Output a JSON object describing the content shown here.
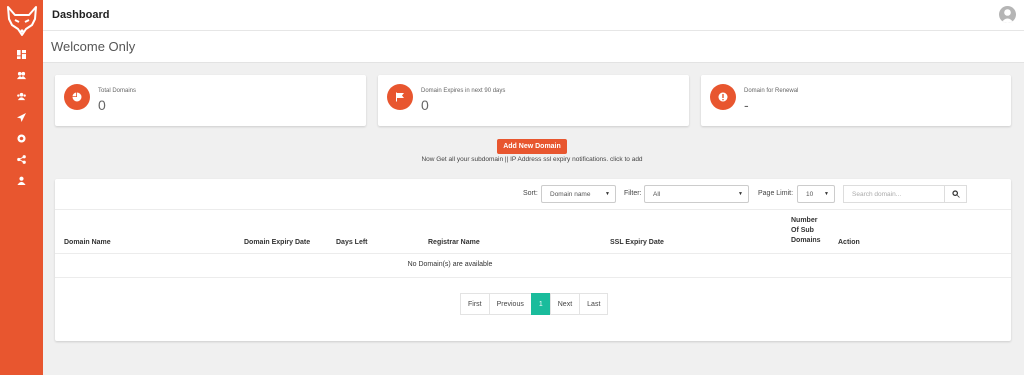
{
  "topbar": {
    "title": "Dashboard"
  },
  "subheader": {
    "welcome": "Welcome Only"
  },
  "sidebar": {
    "items": [
      {
        "icon": "dashboard-icon"
      },
      {
        "icon": "users-icon"
      },
      {
        "icon": "group-icon"
      },
      {
        "icon": "send-icon"
      },
      {
        "icon": "settings-icon"
      },
      {
        "icon": "share-icon"
      },
      {
        "icon": "user-icon"
      }
    ]
  },
  "cards": [
    {
      "label": "Total Domains",
      "value": "0",
      "icon": "pie-chart-icon"
    },
    {
      "label": "Domain Expires in next 90 days",
      "value": "0",
      "icon": "flag-icon"
    },
    {
      "label": "Domain for Renewal",
      "value": "-",
      "icon": "info-icon"
    }
  ],
  "add_domain": {
    "button_label": "Add New Domain",
    "note": "Now Get all your subdomain || IP Address ssl expiry notifications. click to add"
  },
  "filters": {
    "sort_label": "Sort:",
    "sort_value": "Domain name",
    "filter_label": "Filter:",
    "filter_value": "All",
    "page_limit_label": "Page Limit:",
    "page_limit_value": "10",
    "search_placeholder": "Search domain..."
  },
  "table": {
    "headers": {
      "domain_name": "Domain Name",
      "expiry_date": "Domain Expiry Date",
      "days_left": "Days Left",
      "registrar": "Registrar Name",
      "ssl_expiry": "SSL Expiry Date",
      "sub_domains_1": "Number",
      "sub_domains_2": "Of Sub",
      "sub_domains_3": "Domains",
      "action": "Action"
    },
    "empty_message": "No Domain(s) are available"
  },
  "pagination": {
    "first": "First",
    "previous": "Previous",
    "current": "1",
    "next": "Next",
    "last": "Last"
  },
  "colors": {
    "accent": "#e8562f",
    "active_page": "#1abc9c"
  }
}
